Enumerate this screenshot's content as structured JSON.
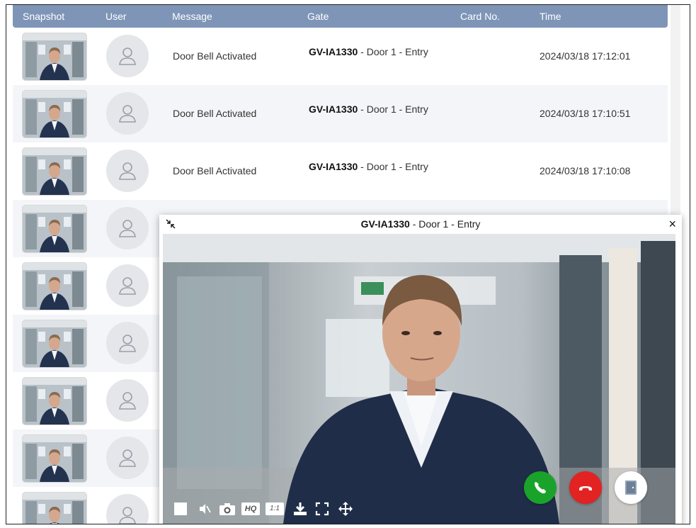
{
  "table": {
    "headers": {
      "snapshot": "Snapshot",
      "user": "User",
      "message": "Message",
      "gate": "Gate",
      "card": "Card No.",
      "time": "Time"
    },
    "rows": [
      {
        "message": "Door Bell Activated",
        "gate_device": "GV-IA1330",
        "gate_rest": " - Door 1 - Entry",
        "time": "2024/03/18 17:12:01"
      },
      {
        "message": "Door Bell Activated",
        "gate_device": "GV-IA1330",
        "gate_rest": " - Door 1 - Entry",
        "time": "2024/03/18 17:10:51"
      },
      {
        "message": "Door Bell Activated",
        "gate_device": "GV-IA1330",
        "gate_rest": " - Door 1 - Entry",
        "time": "2024/03/18 17:10:08"
      }
    ]
  },
  "popup": {
    "device": "GV-IA1330",
    "title_rest": " - Door 1 - Entry",
    "close": "×",
    "controls": {
      "hq": "HQ",
      "one_to_one": "1:1"
    }
  },
  "colors": {
    "header_bg": "#7e95b7",
    "accept": "#1aa32a",
    "reject": "#e32222"
  }
}
